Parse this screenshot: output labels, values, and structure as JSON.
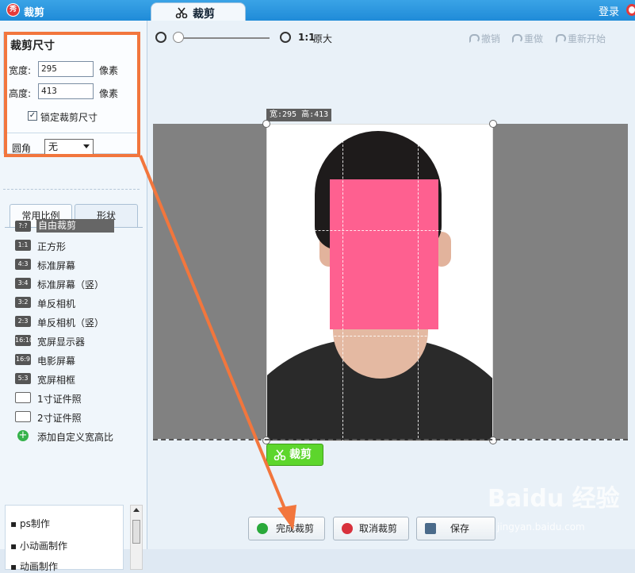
{
  "window": {
    "logo_text": "秀",
    "title": "裁剪",
    "tab_label": "裁剪",
    "login_label": "登录"
  },
  "crop_size": {
    "title": "裁剪尺寸",
    "width_label": "宽度:",
    "width_value": "295",
    "height_label": "高度:",
    "height_value": "413",
    "unit": "像素",
    "lock_label": "锁定裁剪尺寸",
    "lock_checked": true,
    "round_label": "圆角",
    "round_value": "无"
  },
  "tabs": [
    "常用比例",
    "形状"
  ],
  "ratios": [
    {
      "badge": "?:?",
      "label": "自由裁剪",
      "selected": true
    },
    {
      "badge": "1:1",
      "label": "正方形"
    },
    {
      "badge": "4:3",
      "label": "标准屏幕"
    },
    {
      "badge": "3:4",
      "label": "标准屏幕（竖）"
    },
    {
      "badge": "3:2",
      "label": "单反相机"
    },
    {
      "badge": "2:3",
      "label": "单反相机（竖）"
    },
    {
      "badge": "16:10",
      "label": "宽屏显示器"
    },
    {
      "badge": "16:9",
      "label": "电影屏幕"
    },
    {
      "badge": "5:3",
      "label": "宽屏相框"
    },
    {
      "badge": "",
      "label": "1寸证件照",
      "icon": "id-photo-icon"
    },
    {
      "badge": "",
      "label": "2寸证件照",
      "icon": "id-photo-icon"
    },
    {
      "badge": "+",
      "label": "添加自定义宽高比",
      "icon": "add-icon"
    }
  ],
  "samples": [
    "ps制作",
    "小动画制作",
    "动画制作"
  ],
  "toolbar": {
    "zoom_ratio": "1:1",
    "zoom_label": "原大",
    "undo": "撤销",
    "redo": "重做",
    "restart": "重新开始"
  },
  "canvas": {
    "size_label": "宽:295 高:413"
  },
  "crop_button": "裁剪",
  "bottom_buttons": {
    "finish": "完成裁剪",
    "cancel": "取消裁剪",
    "save": "保存"
  },
  "watermark": {
    "main": "Baidu 经验",
    "sub": "jingyan.baidu.com"
  },
  "colors": {
    "titlebar": "#1f8bd8",
    "highlight": "#f2763d",
    "crop_green": "#5dd62c",
    "mask": "#fe6090"
  }
}
